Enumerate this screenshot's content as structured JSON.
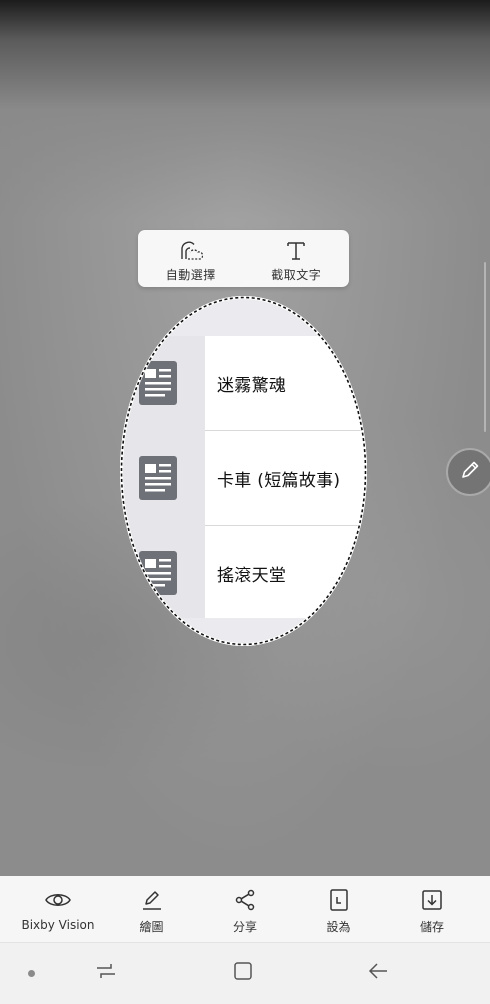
{
  "selection_modes": [
    {
      "label": "自動選擇",
      "icon": "auto-select-icon"
    },
    {
      "label": "截取文字",
      "icon": "extract-text-icon"
    }
  ],
  "captured_list": [
    {
      "title": "迷霧驚魂",
      "icon": "document-icon"
    },
    {
      "title": "卡車 (短篇故事)",
      "icon": "document-icon"
    },
    {
      "title": "搖滾天堂",
      "icon": "document-icon"
    }
  ],
  "toolbar": [
    {
      "label": "Bixby Vision",
      "icon": "eye-icon"
    },
    {
      "label": "繪圖",
      "icon": "draw-icon"
    },
    {
      "label": "分享",
      "icon": "share-icon"
    },
    {
      "label": "設為",
      "icon": "set-as-icon"
    },
    {
      "label": "儲存",
      "icon": "save-icon"
    }
  ],
  "navbar": {
    "buttons": [
      "recent-apps-icon",
      "home-icon",
      "back-icon"
    ]
  },
  "colors": {
    "backdrop": "#8d8d8d",
    "panel": "#f6f6f6",
    "doc_icon": "#6f7178"
  }
}
